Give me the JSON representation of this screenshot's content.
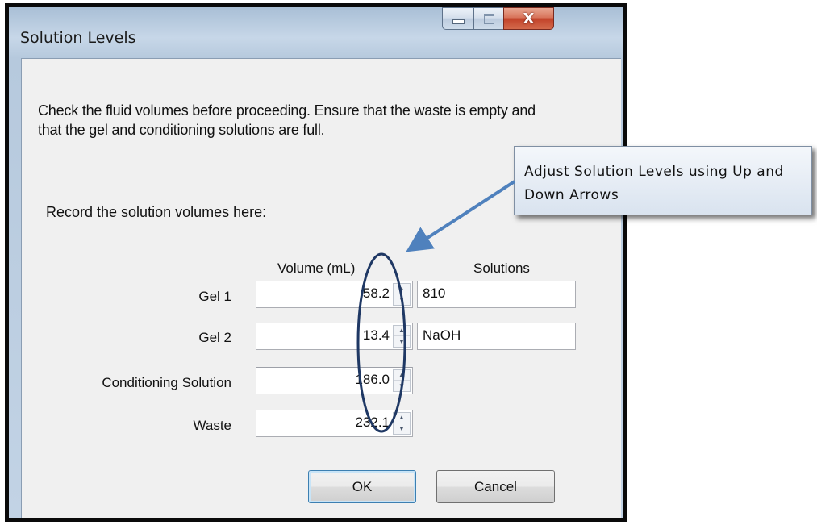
{
  "window": {
    "title": "Solution Levels",
    "controls": {
      "minimize": "minimize",
      "maximize": "maximize",
      "close": "X"
    }
  },
  "dialog": {
    "message": "Check the fluid volumes before proceeding. Ensure that the waste is empty and that the gel and conditioning solutions are full.",
    "prompt": "Record the solution volumes here:",
    "columns": {
      "volume": "Volume (mL)",
      "solutions": "Solutions"
    },
    "rows": [
      {
        "label": "Gel 1",
        "volume": "58.2",
        "solution": "810"
      },
      {
        "label": "Gel 2",
        "volume": "13.4",
        "solution": "NaOH"
      },
      {
        "label": "Conditioning Solution",
        "volume": "186.0"
      },
      {
        "label": "Waste",
        "volume": "232.1"
      }
    ],
    "buttons": {
      "ok": "OK",
      "cancel": "Cancel"
    }
  },
  "annotation": {
    "callout": "Adjust Solution Levels using Up and Down Arrows",
    "arrow_color": "#4f81bd",
    "ellipse_color": "#1f3864"
  },
  "colors": {
    "dialog_background": "#f0f0f0",
    "close_button": "#c2432a",
    "ok_button_border": "#3c7fb1"
  }
}
